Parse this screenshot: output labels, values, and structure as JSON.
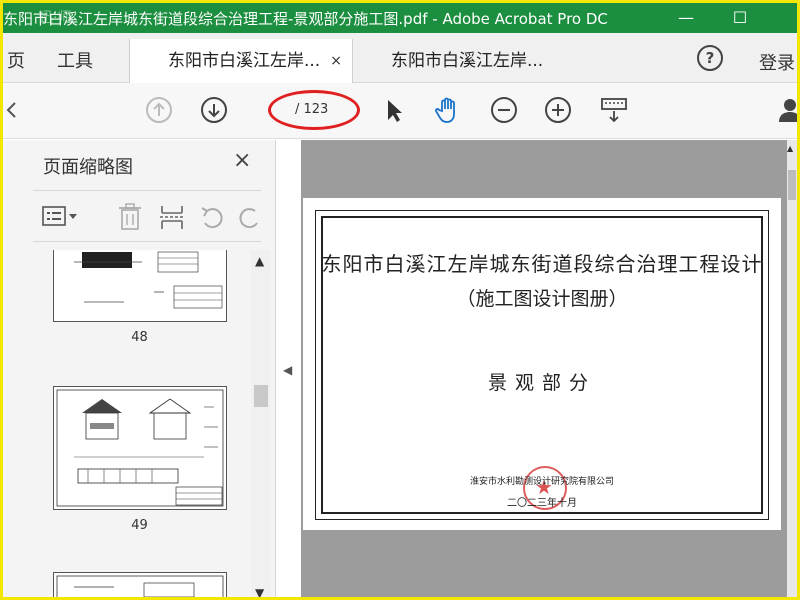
{
  "window": {
    "title": "东阳市白溪江左岸城东街道段综合治理工程-景观部分施工图.pdf - Adobe Acrobat Pro DC",
    "watermark": "迅·师",
    "minimize": "—",
    "maximize": "☐"
  },
  "nav": {
    "home": "页",
    "tools": "工具",
    "help": "?",
    "login": "登录"
  },
  "tabs": [
    {
      "label": "东阳市白溪江左岸...",
      "close": "×",
      "active": true
    },
    {
      "label": "东阳市白溪江左岸...",
      "active": false
    }
  ],
  "toolbar": {
    "page_total": "/ 123",
    "icons": [
      "prev-page-icon",
      "next-page-icon",
      "select-cursor-icon",
      "hand-tool-icon",
      "zoom-out-icon",
      "zoom-in-icon",
      "keyboard-icon"
    ]
  },
  "thumbnail_panel": {
    "title": "页面缩略图",
    "close": "×",
    "thumbnails": [
      {
        "page": "48"
      },
      {
        "page": "49"
      }
    ]
  },
  "document": {
    "title": "东阳市白溪江左岸城东街道段综合治理工程设计",
    "subtitle": "（施工图设计图册）",
    "section": "景观部分",
    "organization": "淮安市水利勘测设计研究院有限公司",
    "date": "二〇二三年十月"
  },
  "colors": {
    "titlebar": "#1b8e3f",
    "annotation_ellipse": "#e02020",
    "hand_tool": "#1a73c9"
  }
}
